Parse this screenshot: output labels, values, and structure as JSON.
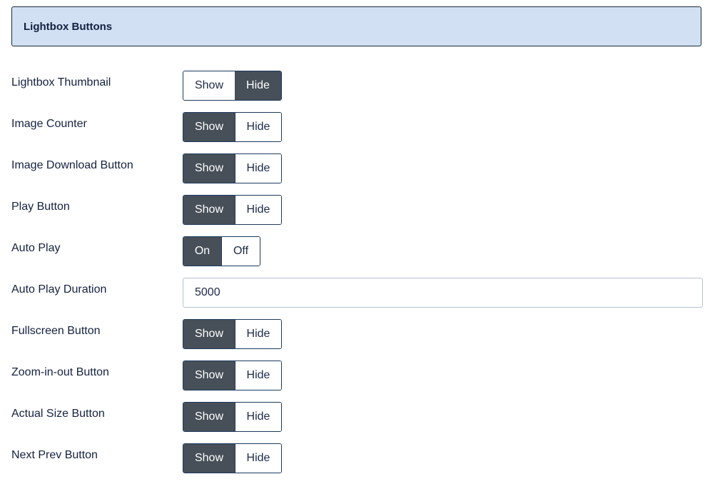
{
  "panel": {
    "title": "Lightbox Buttons"
  },
  "settings": {
    "lightbox_thumbnail": {
      "label": "Lightbox Thumbnail",
      "option_a": "Show",
      "option_b": "Hide",
      "selected": "Hide"
    },
    "image_counter": {
      "label": "Image Counter",
      "option_a": "Show",
      "option_b": "Hide",
      "selected": "Show"
    },
    "image_download": {
      "label": "Image Download Button",
      "option_a": "Show",
      "option_b": "Hide",
      "selected": "Show"
    },
    "play_button": {
      "label": "Play Button",
      "option_a": "Show",
      "option_b": "Hide",
      "selected": "Show"
    },
    "auto_play": {
      "label": "Auto Play",
      "option_a": "On",
      "option_b": "Off",
      "selected": "On"
    },
    "auto_play_duration": {
      "label": "Auto Play Duration",
      "value": "5000"
    },
    "fullscreen": {
      "label": "Fullscreen Button",
      "option_a": "Show",
      "option_b": "Hide",
      "selected": "Show"
    },
    "zoom": {
      "label": "Zoom-in-out Button",
      "option_a": "Show",
      "option_b": "Hide",
      "selected": "Show"
    },
    "actual_size": {
      "label": "Actual Size Button",
      "option_a": "Show",
      "option_b": "Hide",
      "selected": "Show"
    },
    "next_prev": {
      "label": "Next Prev Button",
      "option_a": "Show",
      "option_b": "Hide",
      "selected": "Show"
    }
  },
  "colors": {
    "header_bg": "#d1e0f3",
    "active_bg": "#474f58",
    "text": "#142140"
  }
}
